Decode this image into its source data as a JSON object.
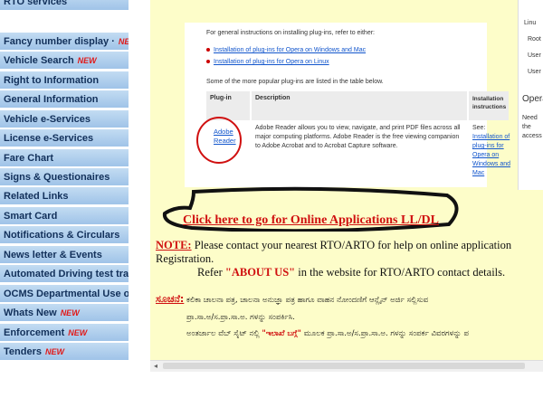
{
  "sidebar": {
    "items": [
      {
        "label": "RTO services",
        "new": false
      },
      {
        "label": "Fancy number display ·",
        "new": true
      },
      {
        "label": "Vehicle Search",
        "new": true
      },
      {
        "label": "Right to Information",
        "new": false
      },
      {
        "label": "General Information",
        "new": false
      },
      {
        "label": "Vehicle e-Services",
        "new": false
      },
      {
        "label": "License e-Services",
        "new": false
      },
      {
        "label": "Fare Chart",
        "new": false
      },
      {
        "label": "Signs & Questionaires",
        "new": false
      },
      {
        "label": "Related Links",
        "new": false
      },
      {
        "label": "Smart Card",
        "new": false
      },
      {
        "label": "Notifications & Circulars",
        "new": false
      },
      {
        "label": "News letter & Events",
        "new": false
      },
      {
        "label": "Automated Driving test track",
        "new": false
      },
      {
        "label": "OCMS Departmental Use only",
        "new": false
      },
      {
        "label": "Whats New",
        "new": true
      },
      {
        "label": "Enforcement",
        "new": true
      },
      {
        "label": "Tenders",
        "new": true
      }
    ],
    "new_badge": "NEW"
  },
  "plugin_info": {
    "intro": "For general instructions on installing plug-ins, refer to either:",
    "links": [
      "Installation of plug-ins for Opera on Windows and Mac",
      "Installation of plug-ins for Opera on Linux"
    ],
    "popular": "Some of the more popular plug-ins are listed in the table below.",
    "table": {
      "headers": [
        "Plug-in",
        "Description",
        "Installation instructions"
      ],
      "plugin_name": "Adobe Reader",
      "description": "Adobe Reader allows you to view, navigate, and print PDF files across all major computing platforms. Adobe Reader is the free viewing companion to Adobe Acrobat and to Acrobat Capture software.",
      "install_see": "See:",
      "install_link": "Installation of plug-ins for Opera on Windows and Mac"
    },
    "side_panel": {
      "items": [
        "Linu",
        "Root",
        "User",
        "User"
      ],
      "title": "Opera",
      "text": "Need the access"
    }
  },
  "main": {
    "apply_link": "Click here to go for Online Applications LL/DL",
    "note_label": "NOTE:",
    "note_text": "Please contact your nearest RTO/ARTO for help on online application Registration.",
    "refer_text_1": "Refer",
    "refer_about": "\"ABOUT US\"",
    "refer_text_2": "in the website for RTO/ARTO contact details.",
    "kn_label": "ಸೂಚನೆ:",
    "kn_line1": "ಕಲಿಕಾ ಚಾಲನಾ ಪತ್ರ, ಚಾಲನಾ ಅನುಜ್ಞಾ ಪತ್ರ ಹಾಗೂ ವಾಹನ ನೋಂದಣಿಗೆ ಆನ್ಲೈನ್ ಅರ್ಜಿ ಸಲ್ಲಿಸುವ",
    "kn_line2": "ಪ್ರಾ.ಸಾ.ಅ/ಸ.ಪ್ರಾ.ಸಾ.ಅ. ಗಳನ್ನು ಸಂಪರ್ಕಿಸಿ.",
    "kn_line3_a": "ಅಂತರ್ಜಾಲ ವೆಬ್ ಸೈಟ್ ನಲ್ಲಿ",
    "kn_line3_b": "\"ಇಲಾಖೆ ಬಗ್ಗೆ\"",
    "kn_line3_c": "ಮೂಲಕ ಪ್ರಾ.ಸಾ.ಅ/ಸ.ಪ್ರಾ.ಸಾ.ಅ. ಗಳನ್ನು ಸಂಪರ್ಕ ವಿವರಗಳನ್ನು ಪ"
  }
}
